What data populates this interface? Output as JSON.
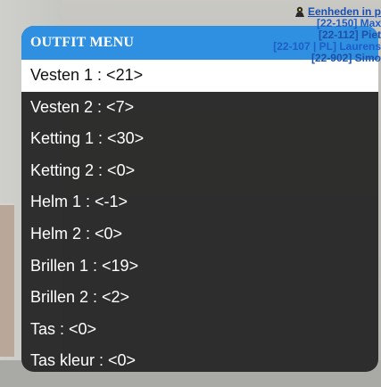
{
  "hud": {
    "title": "Eenheden in p",
    "rows": [
      "[22-150] Max",
      "[22-112] Piet",
      "[22-107 | PL] Laurens",
      "[22-902] Simo"
    ]
  },
  "menu": {
    "title": "OUTFIT MENU",
    "selected_index": 0,
    "items": [
      "Vesten 1 : <21>",
      "Vesten 2 : <7>",
      "Ketting 1 : <30>",
      "Ketting 2 : <0>",
      "Helm 1 : <-1>",
      "Helm 2 : <0>",
      "Brillen 1 : <19>",
      "Brillen 2 : <2>",
      "Tas : <0>",
      "Tas kleur : <0>"
    ]
  },
  "colors": {
    "header": "#2f8fe0",
    "panel": "#282828",
    "selected_bg": "#ffffff",
    "hud_text": "#1a4fb3"
  }
}
